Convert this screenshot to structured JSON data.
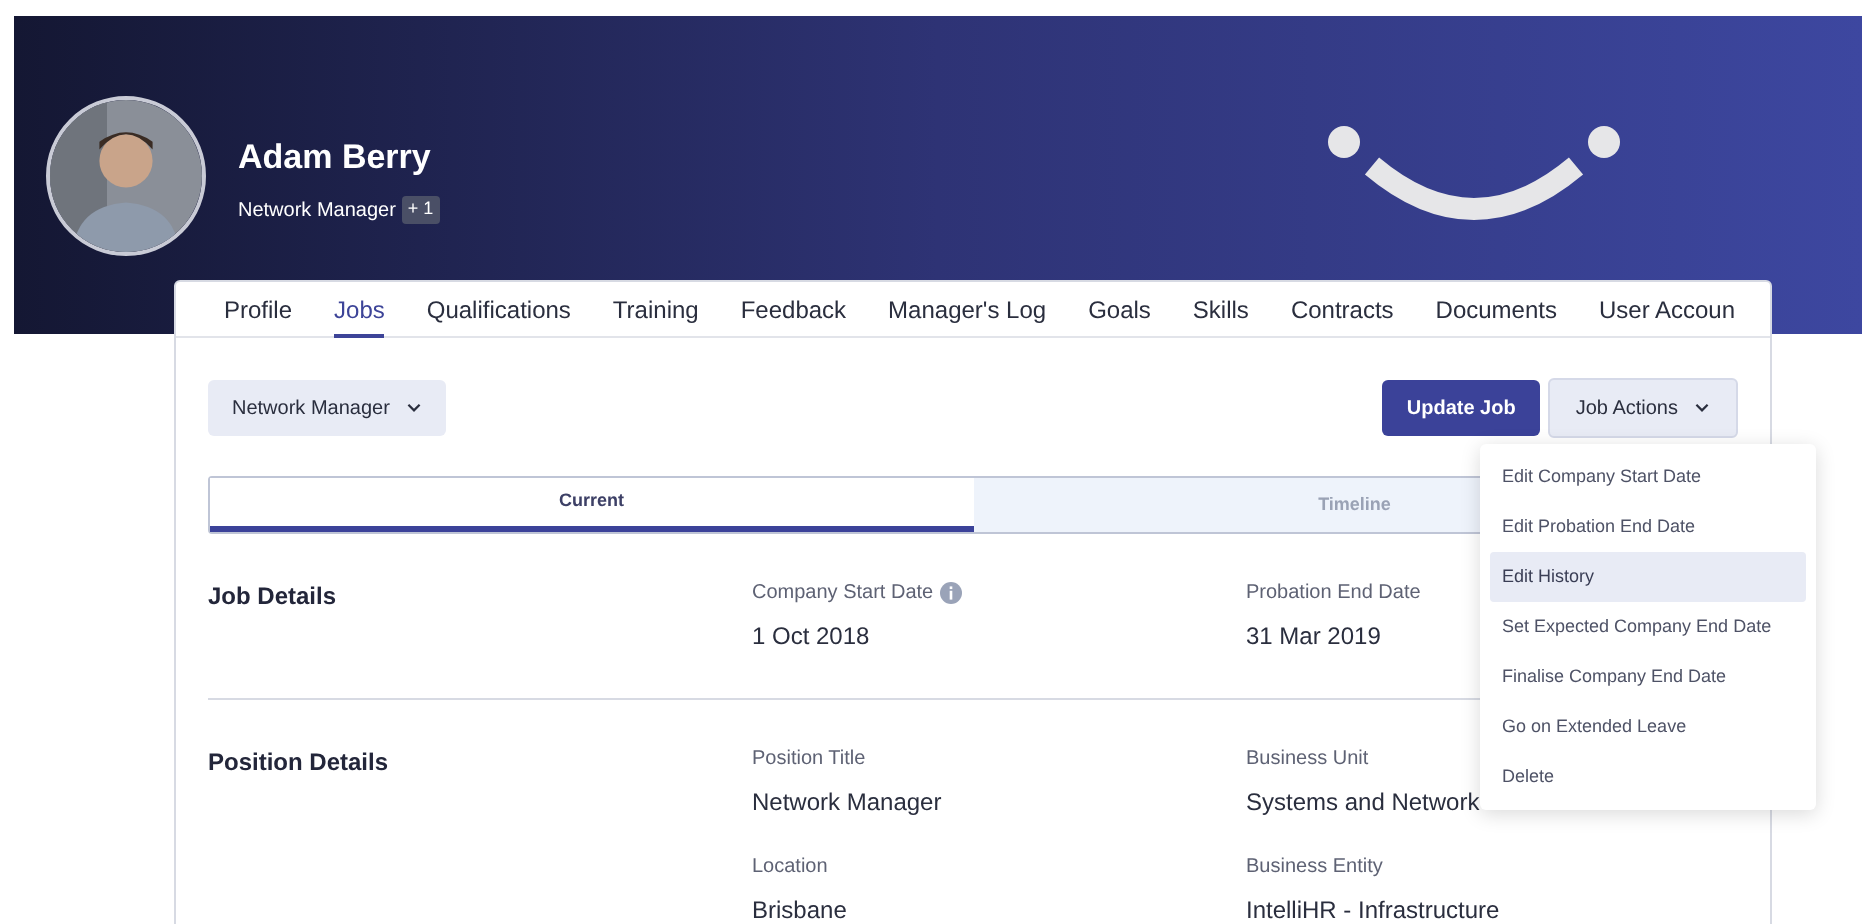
{
  "profile": {
    "name": "Adam Berry",
    "title": "Network Manager",
    "badge": "+ 1"
  },
  "tabs": [
    {
      "label": "Profile",
      "selected": false
    },
    {
      "label": "Jobs",
      "selected": true
    },
    {
      "label": "Qualifications",
      "selected": false
    },
    {
      "label": "Training",
      "selected": false
    },
    {
      "label": "Feedback",
      "selected": false
    },
    {
      "label": "Manager's Log",
      "selected": false
    },
    {
      "label": "Goals",
      "selected": false
    },
    {
      "label": "Skills",
      "selected": false
    },
    {
      "label": "Contracts",
      "selected": false
    },
    {
      "label": "Documents",
      "selected": false
    },
    {
      "label": "User Accoun",
      "selected": false
    }
  ],
  "job_selector": {
    "label": "Network Manager"
  },
  "buttons": {
    "update_job": "Update Job",
    "job_actions": "Job Actions"
  },
  "view_tabs": [
    {
      "label": "Current",
      "selected": true
    },
    {
      "label": "Timeline",
      "selected": false
    }
  ],
  "sections": [
    {
      "title": "Job Details",
      "fields": [
        {
          "label": "Company Start Date",
          "value": "1 Oct 2018",
          "info": true
        },
        {
          "label": "Probation End Date",
          "value": "31 Mar 2019",
          "info": false
        }
      ]
    },
    {
      "title": "Position Details",
      "fields": [
        {
          "label": "Position Title",
          "value": "Network Manager",
          "info": false
        },
        {
          "label": "Business Unit",
          "value": "Systems and Network",
          "info": false
        },
        {
          "label": "Location",
          "value": "Brisbane",
          "info": false
        },
        {
          "label": "Business Entity",
          "value": "IntelliHR - Infrastructure",
          "info": false
        }
      ]
    }
  ],
  "job_actions_menu": [
    {
      "label": "Edit Company Start Date",
      "highlighted": false
    },
    {
      "label": "Edit Probation End Date",
      "highlighted": false
    },
    {
      "label": "Edit History",
      "highlighted": true
    },
    {
      "label": "Set Expected Company End Date",
      "highlighted": false
    },
    {
      "label": "Finalise Company End Date",
      "highlighted": false
    },
    {
      "label": "Go on Extended Leave",
      "highlighted": false
    },
    {
      "label": "Delete",
      "highlighted": false
    }
  ]
}
